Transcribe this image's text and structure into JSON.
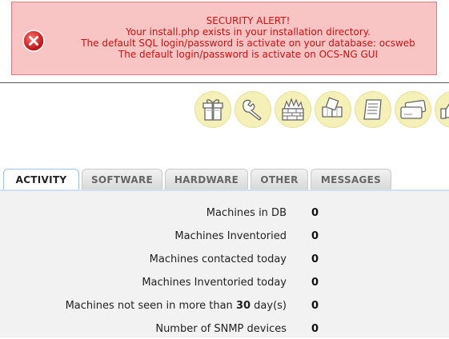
{
  "alert": {
    "title": "SECURITY ALERT!",
    "lines": [
      "Your install.php exists in your installation directory.",
      "The default SQL login/password is activate on your database: ocsweb",
      "The default login/password is activate on OCS-NG GUI"
    ],
    "icon": "close-icon",
    "colors": {
      "background": "#f8c4c4",
      "border": "#e07a7a",
      "text": "#cc1111"
    }
  },
  "toolbar": {
    "icons": [
      "gift-box-icon",
      "wrench-icon",
      "firewall-icon",
      "cubes-icon",
      "scroll-document-icon",
      "cards-icon",
      "thumbs-up-icon"
    ]
  },
  "tabs": [
    {
      "label": "ACTIVITY",
      "active": true
    },
    {
      "label": "SOFTWARE",
      "active": false
    },
    {
      "label": "HARDWARE",
      "active": false
    },
    {
      "label": "OTHER",
      "active": false
    },
    {
      "label": "MESSAGES",
      "active": false
    }
  ],
  "stats": [
    {
      "label": "Machines in DB",
      "value": "0"
    },
    {
      "label": "Machines Inventoried",
      "value": "0"
    },
    {
      "label": "Machines contacted today",
      "value": "0"
    },
    {
      "label": "Machines Inventoried today",
      "value": "0"
    },
    {
      "label_before": "Machines not seen in more than ",
      "label_days": "30",
      "label_after": " day(s)",
      "value": "0"
    },
    {
      "label": "Number of SNMP devices",
      "value": "0"
    }
  ]
}
